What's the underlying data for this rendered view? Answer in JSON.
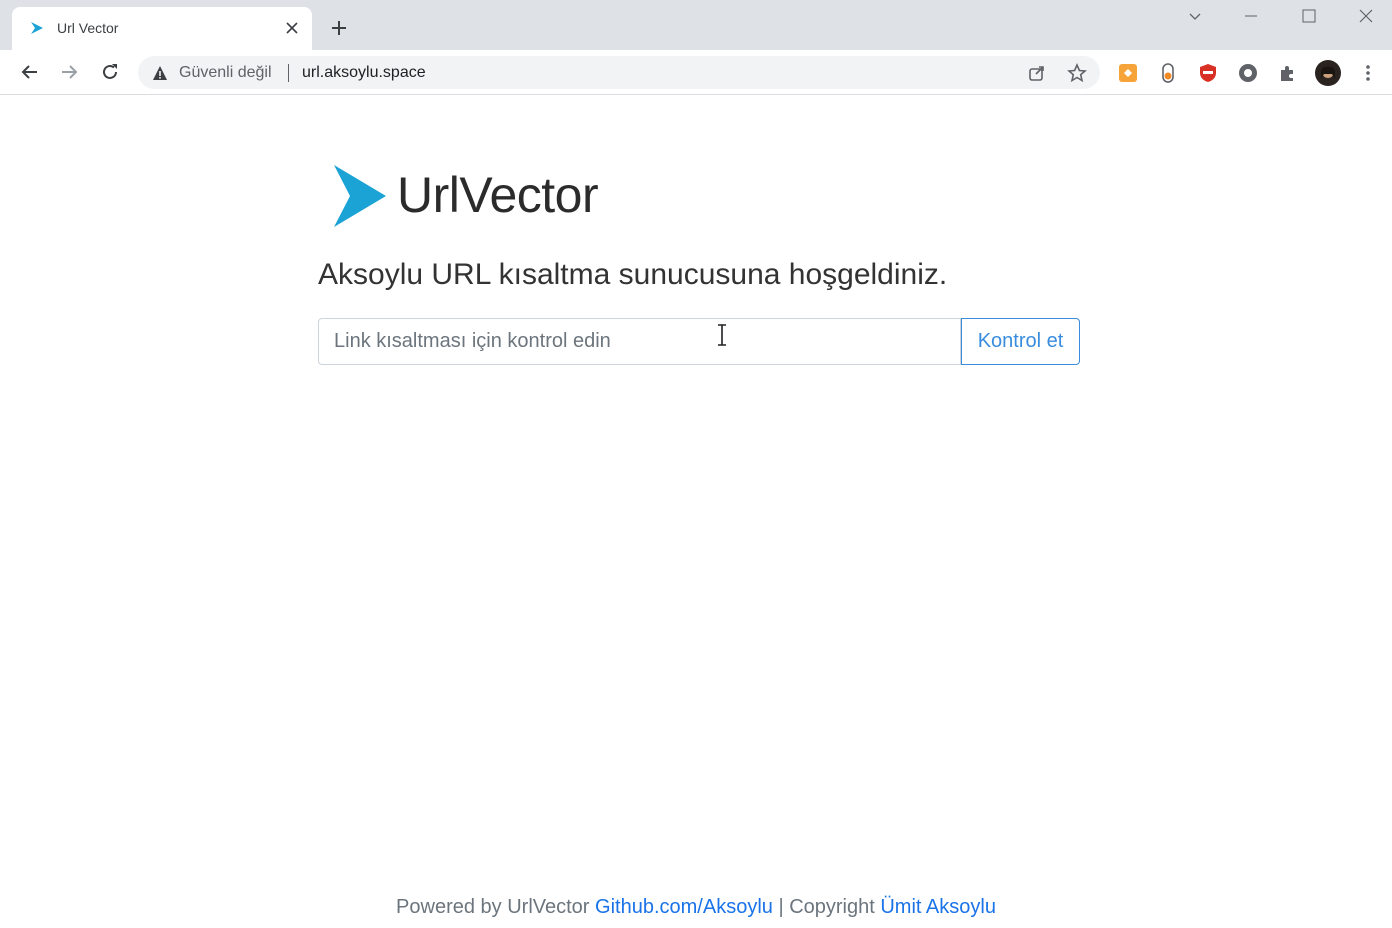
{
  "browser": {
    "tab_title": "Url Vector",
    "security_label": "Güvenli değil",
    "url": "url.aksoylu.space"
  },
  "page": {
    "brand_name": "UrlVector",
    "welcome_text": "Aksoylu URL kısaltma sunucusuna hoşgeldiniz.",
    "search_placeholder": "Link kısaltması için kontrol edin",
    "search_value": "",
    "check_button_label": "Kontrol et"
  },
  "footer": {
    "powered_prefix": "Powered by UrlVector",
    "github_link": "Github.com/Aksoylu",
    "copyright_prefix": " | Copyright ",
    "author_link": "Ümit Aksoylu"
  },
  "colors": {
    "accent": "#3a8dde",
    "logo": "#1aa3d4",
    "link": "#1a73e8"
  },
  "icons": [
    "back-arrow-icon",
    "forward-arrow-icon",
    "reload-icon",
    "warning-icon",
    "share-icon",
    "star-icon",
    "extensions-icon",
    "menu-icon"
  ]
}
